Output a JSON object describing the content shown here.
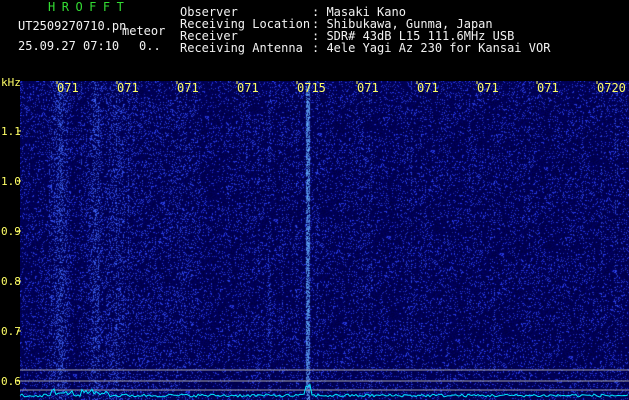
{
  "header": {
    "app_title": "HROFFT",
    "file_name": "UT2509270710.pn",
    "file_tag": "meteor",
    "timestamp": "25.09.27 07:10",
    "extra": "0.."
  },
  "observation": {
    "observer": {
      "label": "Observer",
      "value": ": Masaki Kano"
    },
    "location": {
      "label": "Receiving Location",
      "value": ": Shibukawa, Gunma, Japan"
    },
    "receiver": {
      "label": "Receiver",
      "value": ": SDR# 43dB L15 111.6MHz USB"
    },
    "antenna": {
      "label": "Receiving Antenna",
      "value": ": 4ele Yagi Az 230 for Kansai VOR"
    }
  },
  "axes": {
    "y_unit": "kHz",
    "y_ticks": [
      "1.1",
      "1.0",
      "0.9",
      "0.8",
      "0.7",
      "0.6"
    ],
    "x_ticks": [
      "071",
      "071",
      "071",
      "071",
      "0715",
      "071",
      "071",
      "071",
      "071",
      "0720"
    ]
  },
  "colors": {
    "background": "#000000",
    "plot_background": "#000050",
    "signal": "#3c5cff",
    "trace": "#00e8ff",
    "title_green": "#33dd33",
    "axis_yellow": "#ffff66"
  }
}
